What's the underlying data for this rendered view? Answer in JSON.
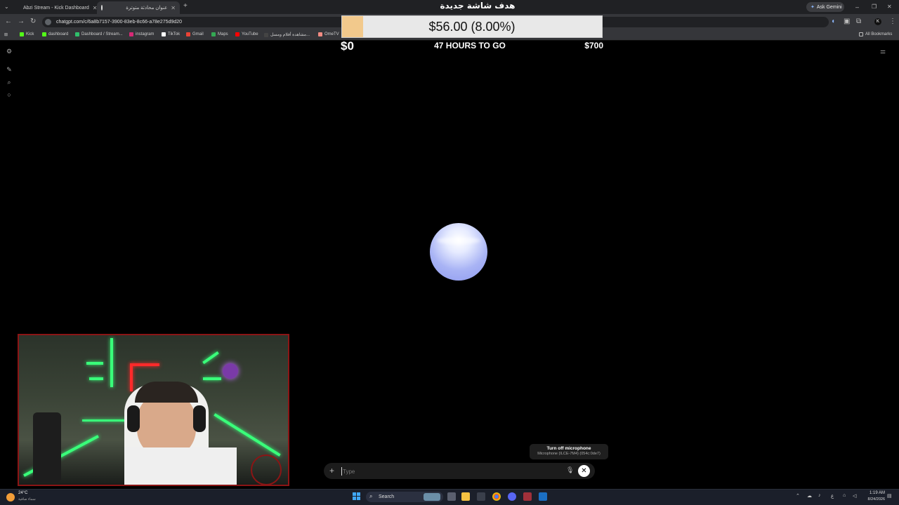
{
  "browser": {
    "tabs": [
      {
        "label": "Abzi Stream - Kick Dashboard",
        "active": false
      },
      {
        "label": "عنوان محادثة متوترة",
        "active": true
      }
    ],
    "url": "chatgpt.com/c/6a8b7157-3900-83eb-8c66-a78e275d9d20",
    "ask_gemini": "Ask Gemini",
    "all_bookmarks": "All Bookmarks",
    "bookmarks": [
      "Kick",
      "dashboard",
      "Dashboard / Stream...",
      "instagram",
      "TikTok",
      "Gmail",
      "Maps",
      "YouTube",
      "مشاهدة أفلام ومسل...",
      "OmeTV"
    ]
  },
  "goal": {
    "title": "هدف شاشة جديدة",
    "amount_label": "$56.00 (8.00%)",
    "progress_percent": 8,
    "min_label": "$0",
    "time_label": "47 HOURS TO GO",
    "max_label": "$700",
    "fill_color": "#f2c98c"
  },
  "composer": {
    "placeholder": "Type",
    "tooltip_title": "Turn off microphone",
    "tooltip_subtitle": "Microphone (ILCE-7M4) (054c:0de7)"
  },
  "taskbar": {
    "weather_temp": "24°C",
    "weather_desc": "سماء صافية",
    "search_label": "Search",
    "time": "1:19 AM",
    "date": "8/24/2026",
    "lang": "ع"
  }
}
